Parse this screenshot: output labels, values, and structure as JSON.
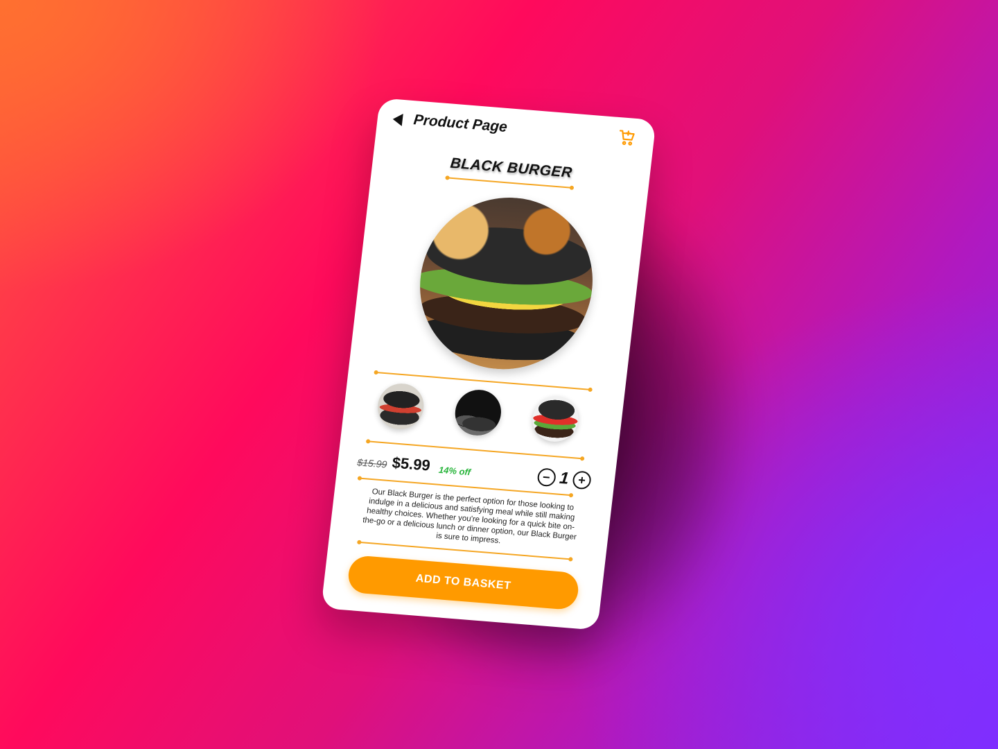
{
  "header": {
    "title": "Product Page",
    "back_icon": "back-arrow-icon",
    "cart_icon": "cart-icon"
  },
  "product": {
    "name": "BLACK BURGER",
    "image": "black-burger-photo",
    "thumbnails": [
      "burger-thumbnail-1",
      "burger-thumbnail-2",
      "burger-thumbnail-3"
    ],
    "price_old": "$15.99",
    "price_new": "$5.99",
    "discount": "14% off",
    "quantity": "1",
    "quantity_minus": "−",
    "quantity_plus": "+",
    "description": "Our Black Burger is the perfect option for those looking to indulge in a delicious and satisfying meal while still making healthy choices. Whether you're looking for a quick bite on-the-go or a delicious lunch or dinner option, our Black Burger is sure to impress."
  },
  "actions": {
    "add_to_basket": "ADD TO BASKET"
  },
  "colors": {
    "accent": "#ff9a00",
    "divider": "#f5a623",
    "discount": "#27b43a"
  }
}
